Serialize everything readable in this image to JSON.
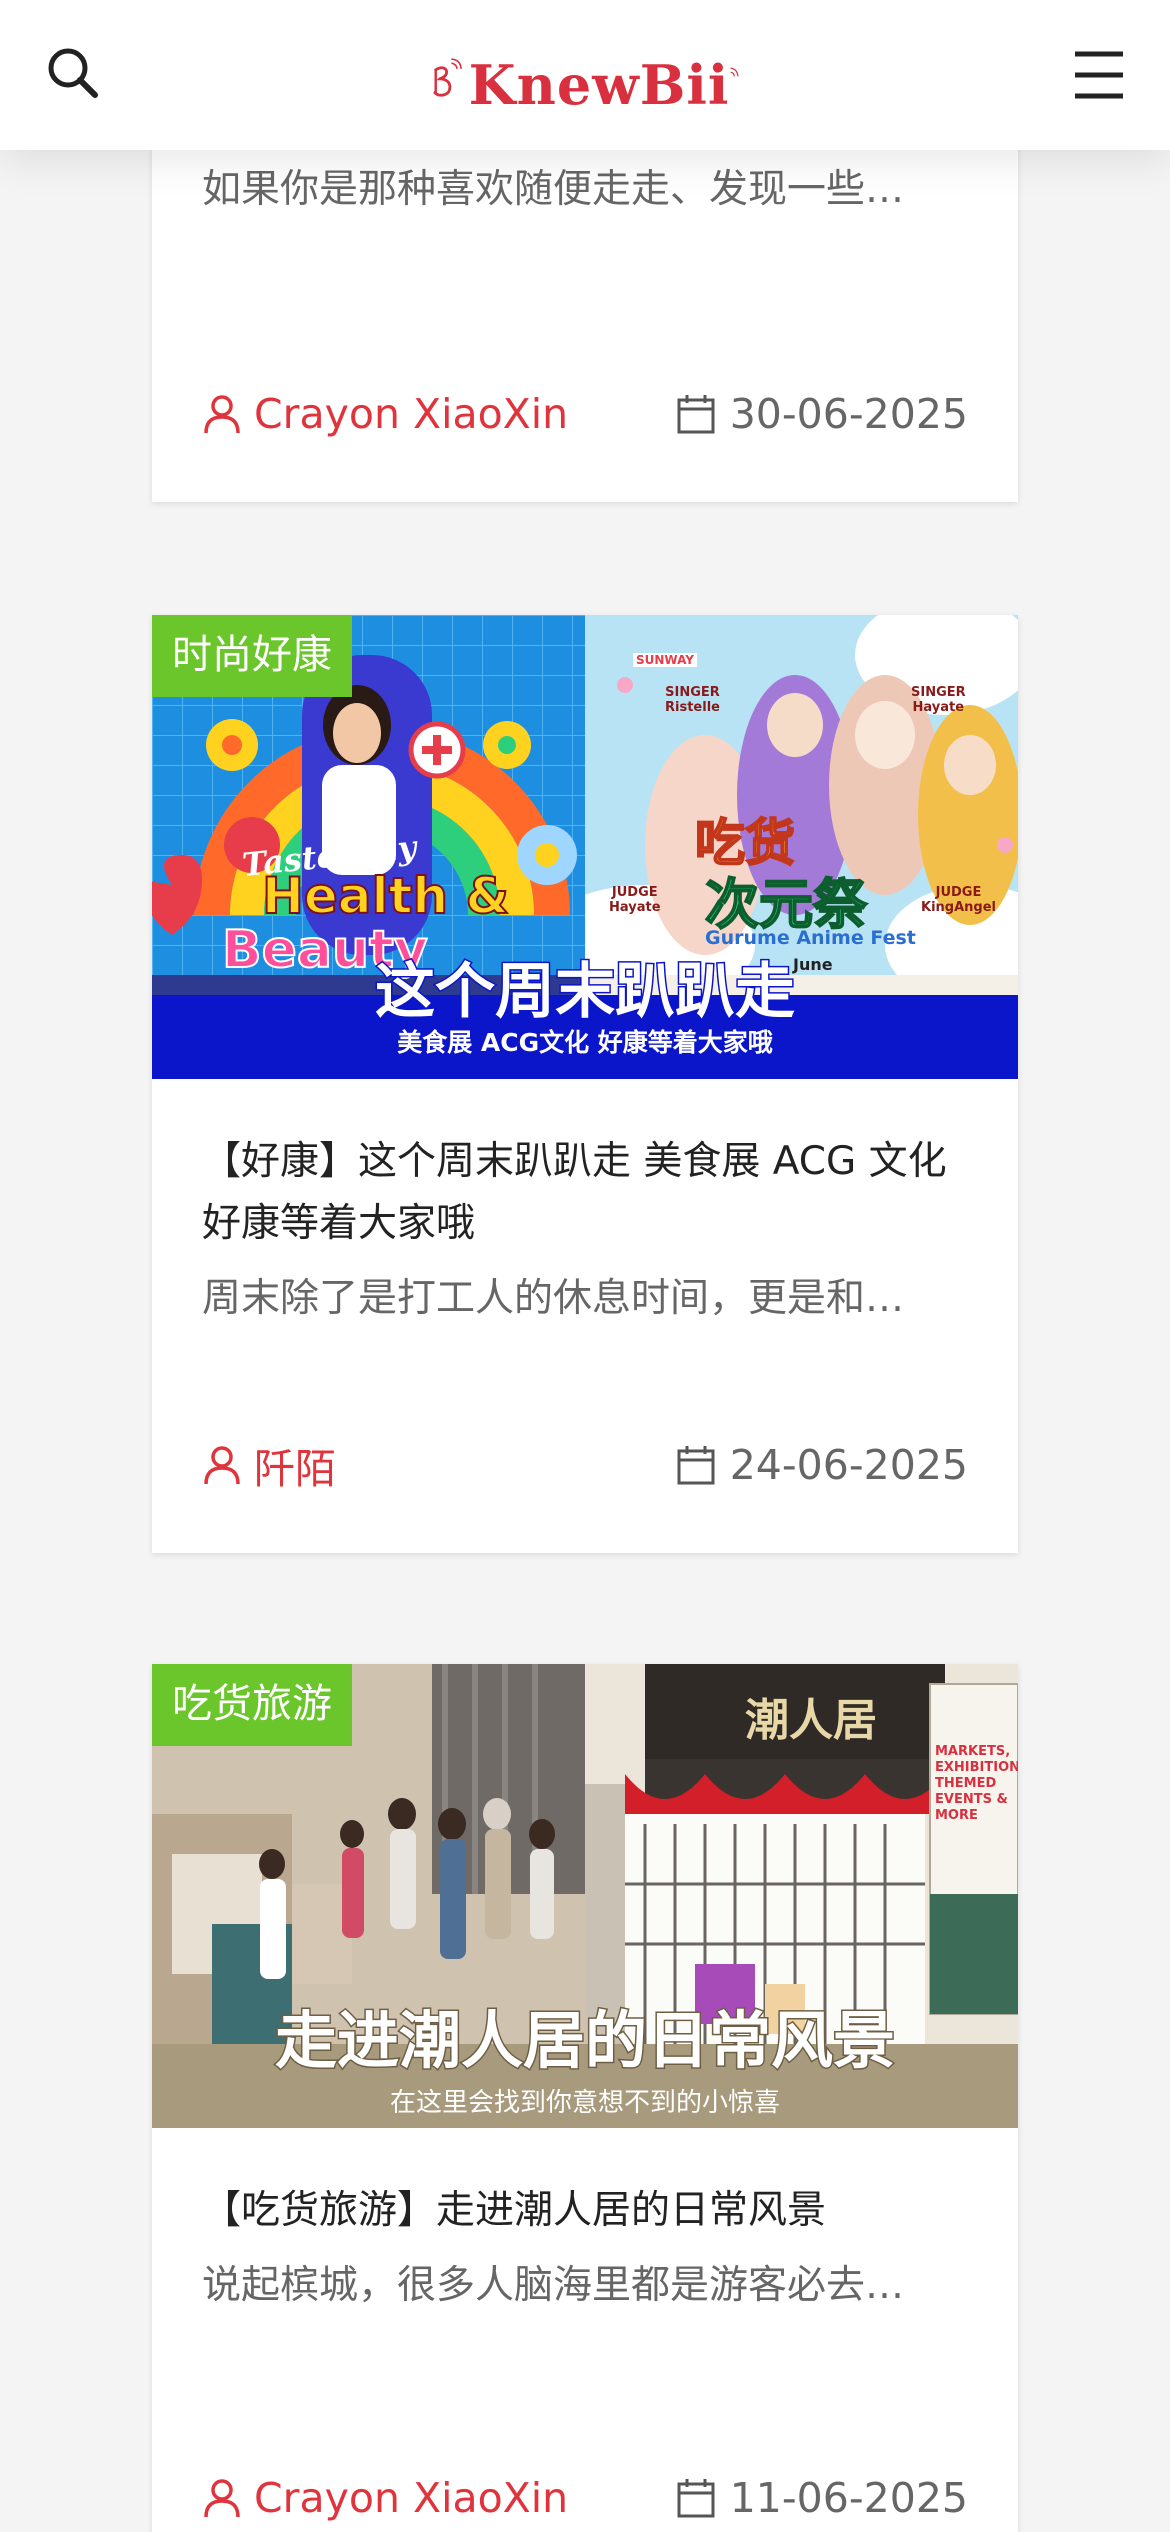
{
  "header": {
    "logo_text": "KnewBii",
    "search_icon": "search-icon",
    "menu_icon": "hamburger-menu-icon"
  },
  "colors": {
    "accent": "#d8303e",
    "badge": "#6ac62b",
    "banner_blue": "#0b15c9",
    "banner_tan": "#a89a7d"
  },
  "cards": [
    {
      "excerpt": "如果你是那种喜欢随便走走、发现一些…",
      "author": "Crayon XiaoXin",
      "date": "30-06-2025"
    },
    {
      "category": "时尚好康",
      "title": "【好康】这个周末趴趴走 美食展 ACG 文化 好康等着大家哦",
      "excerpt": "周末除了是打工人的休息时间，更是和…",
      "author": "阡陌",
      "date": "24-06-2025",
      "image": {
        "left_script": "Tastefully",
        "left_big": "Health &",
        "left_big2": "Beauty",
        "right_title": "吃货",
        "right_title2": "次元祭",
        "right_sub": "Gurume Anime Fest",
        "singer1": "SINGER",
        "singer1_name": "Ristelle",
        "singer2": "SINGER",
        "singer2_name": "Hayate",
        "judge1": "JUDGE",
        "judge1_name": "Hayate",
        "judge2": "JUDGE",
        "judge2_name": "KingAngel",
        "sponsor": "SUNWAY",
        "june": "June",
        "headline": "这个周末趴趴走",
        "subline": "美食展 ACG文化 好康等着大家哦"
      }
    },
    {
      "category": "吃货旅游",
      "title": "【吃货旅游】走进潮人居的日常风景",
      "excerpt": "说起槟城，很多人脑海里都是游客必去…",
      "author": "Crayon XiaoXin",
      "date": "11-06-2025",
      "image": {
        "sign": "潮人居",
        "poster": "MARKETS, EXHIBITIONS, THEMED EVENTS & MORE",
        "headline": "走进潮人居的日常风景",
        "subline": "在这里会找到你意想不到的小惊喜"
      }
    }
  ]
}
